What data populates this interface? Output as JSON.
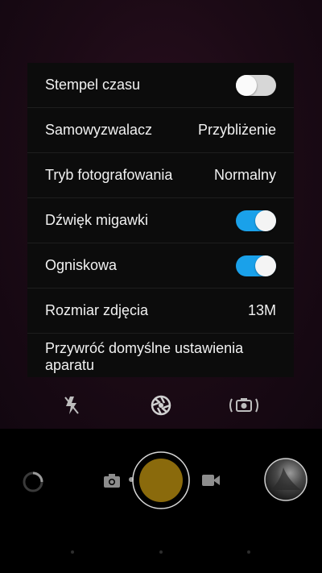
{
  "settings": {
    "rows": [
      {
        "label": "Stempel czasu",
        "type": "toggle",
        "state": "off"
      },
      {
        "label": "Samowyzwalacz",
        "value": "Przybliżenie"
      },
      {
        "label": "Tryb fotografowania",
        "value": "Normalny"
      },
      {
        "label": "Dźwięk migawki",
        "type": "toggle",
        "state": "on"
      },
      {
        "label": "Ogniskowa",
        "type": "toggle",
        "state": "on"
      },
      {
        "label": "Rozmiar zdjęcia",
        "value": "13M"
      },
      {
        "label": "Przywróć domyślne ustawienia aparatu"
      }
    ]
  },
  "mode_icons": [
    "flash-off-icon",
    "aperture-icon",
    "camera-switch-icon"
  ],
  "bottom": {
    "icons": [
      "loading-ring-icon",
      "photo-mode-icon",
      "shutter-button",
      "video-mode-icon",
      "gallery-thumbnail"
    ]
  },
  "colors": {
    "toggle_on": "#1aa1ea",
    "toggle_off": "#d7d7d7",
    "shutter": "#8a6a0c"
  }
}
